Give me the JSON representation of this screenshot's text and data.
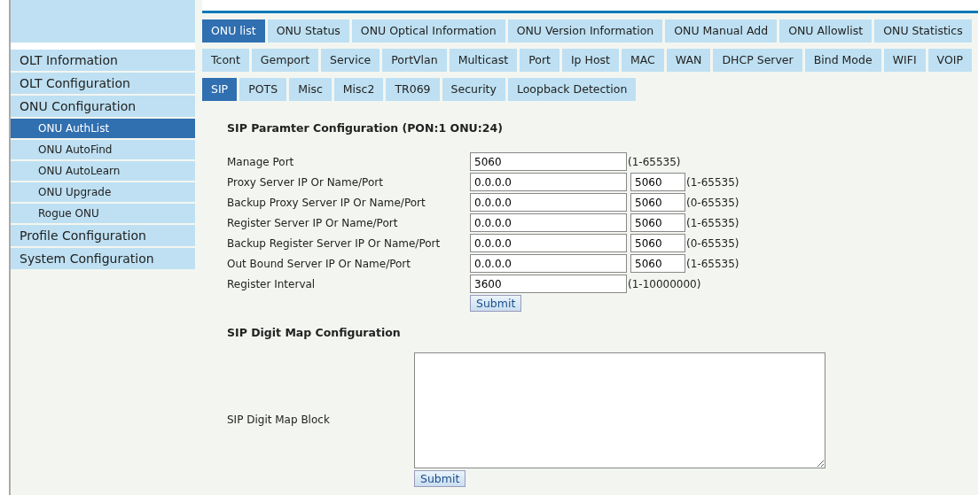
{
  "sidebar": {
    "items": [
      {
        "label": "OLT Information",
        "selected": false
      },
      {
        "label": "OLT Configuration",
        "selected": false
      },
      {
        "label": "ONU Configuration",
        "selected": false,
        "children": [
          {
            "label": "ONU AuthList",
            "selected": true
          },
          {
            "label": "ONU AutoFind",
            "selected": false
          },
          {
            "label": "ONU AutoLearn",
            "selected": false
          },
          {
            "label": "ONU Upgrade",
            "selected": false
          },
          {
            "label": "Rogue ONU",
            "selected": false
          }
        ]
      },
      {
        "label": "Profile Configuration",
        "selected": false
      },
      {
        "label": "System Configuration",
        "selected": false
      }
    ]
  },
  "tab_rows": [
    [
      {
        "label": "ONU list",
        "selected": true
      },
      {
        "label": "ONU Status",
        "selected": false
      },
      {
        "label": "ONU Optical Information",
        "selected": false
      },
      {
        "label": "ONU Version Information",
        "selected": false
      },
      {
        "label": "ONU Manual Add",
        "selected": false
      },
      {
        "label": "ONU Allowlist",
        "selected": false
      },
      {
        "label": "ONU Statistics",
        "selected": false
      }
    ],
    [
      {
        "label": "Tcont",
        "selected": false
      },
      {
        "label": "Gemport",
        "selected": false
      },
      {
        "label": "Service",
        "selected": false
      },
      {
        "label": "PortVlan",
        "selected": false
      },
      {
        "label": "Multicast",
        "selected": false
      },
      {
        "label": "Port",
        "selected": false
      },
      {
        "label": "Ip Host",
        "selected": false
      },
      {
        "label": "MAC",
        "selected": false
      },
      {
        "label": "WAN",
        "selected": false
      },
      {
        "label": "DHCP Server",
        "selected": false
      },
      {
        "label": "Bind Mode",
        "selected": false
      },
      {
        "label": "WIFI",
        "selected": false
      },
      {
        "label": "VOIP",
        "selected": false
      }
    ],
    [
      {
        "label": "SIP",
        "selected": true
      },
      {
        "label": "POTS",
        "selected": false
      },
      {
        "label": "Misc",
        "selected": false
      },
      {
        "label": "Misc2",
        "selected": false
      },
      {
        "label": "TR069",
        "selected": false
      },
      {
        "label": "Security",
        "selected": false
      },
      {
        "label": "Loopback Detection",
        "selected": false
      }
    ]
  ],
  "sip_parameters": {
    "title": "SIP Paramter Configuration (PON:1 ONU:24)",
    "rows": [
      {
        "label": "Manage Port",
        "value": "5060",
        "range": "(1-65535)"
      },
      {
        "label": "Proxy Server IP Or Name/Port",
        "value": "0.0.0.0",
        "port": "5060",
        "range": "(1-65535)"
      },
      {
        "label": "Backup Proxy Server IP Or Name/Port",
        "value": "0.0.0.0",
        "port": "5060",
        "range": "(0-65535)"
      },
      {
        "label": "Register Server IP Or Name/Port",
        "value": "0.0.0.0",
        "port": "5060",
        "range": "(1-65535)"
      },
      {
        "label": "Backup Register Server IP Or Name/Port",
        "value": "0.0.0.0",
        "port": "5060",
        "range": "(0-65535)"
      },
      {
        "label": "Out Bound Server IP Or Name/Port",
        "value": "0.0.0.0",
        "port": "5060",
        "range": "(1-65535)"
      },
      {
        "label": "Register Interval",
        "value": "3600",
        "range": "(1-10000000)"
      }
    ],
    "submit": "Submit"
  },
  "digit_map": {
    "title": "SIP Digit Map Configuration",
    "label": "SIP Digit Map Block",
    "submit": "Submit"
  }
}
